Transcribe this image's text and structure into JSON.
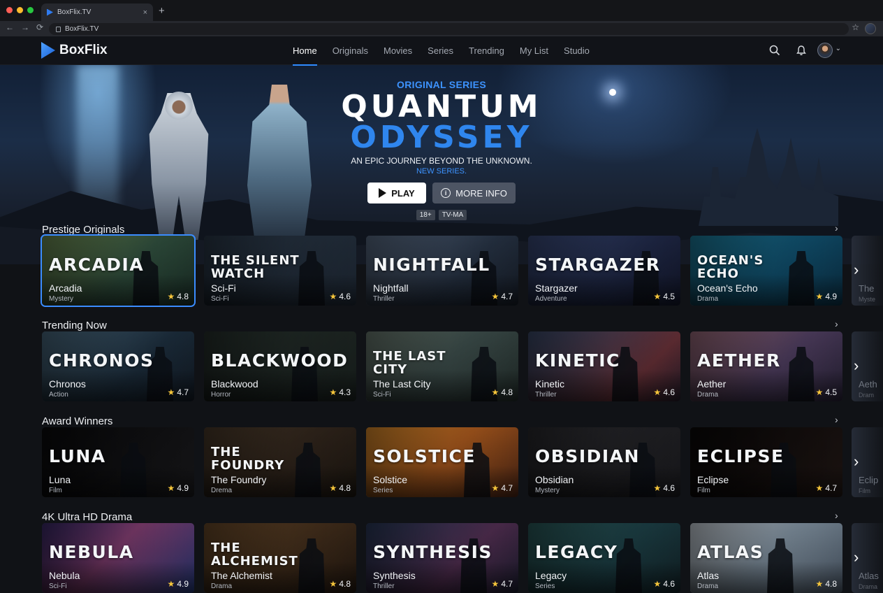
{
  "browser": {
    "tab_title": "BoxFlix.TV",
    "new_tab": "+",
    "close": "×",
    "url": "BoxFlix.TV",
    "back": "←",
    "forward": "→",
    "reload": "⟳",
    "bookmark": "☆"
  },
  "header": {
    "logo": "BoxFlix",
    "nav": [
      "Home",
      "Originals",
      "Movies",
      "Series",
      "Trending",
      "My List",
      "Studio"
    ],
    "active_nav": "Home",
    "caret": "⌄"
  },
  "hero": {
    "eyebrow": "ORIGINAL SERIES",
    "title_line1": "QUANTUM",
    "title_line2": "ODYSSEY",
    "tagline": "AN EPIC JOURNEY BEYOND THE UNKNOWN.",
    "tagline2": "NEW SERIES.",
    "play_label": "PLAY",
    "info_label": "MORE INFO",
    "info_glyph": "i",
    "badges": [
      "18+",
      "TV-MA"
    ]
  },
  "rows": [
    {
      "title": "Prestige Originals",
      "cards": [
        {
          "art": "ARCADIA",
          "name": "Arcadia",
          "genre": "Mystery",
          "rating": "4.8"
        },
        {
          "art": "THE SILENT WATCH",
          "name": "The Silent Watch",
          "display_name": "Sci-Fi",
          "genre": "Sci-Fi",
          "rating": "4.6"
        },
        {
          "art": "NIGHTFALL",
          "name": "Nightfall",
          "genre": "Thriller",
          "rating": "4.7"
        },
        {
          "art": "STARGAZER",
          "name": "Stargazer",
          "genre": "Adventure",
          "rating": "4.5"
        },
        {
          "art": "OCEAN'S ECHO",
          "name": "Ocean's Echo",
          "genre": "Drama",
          "rating": "4.9"
        }
      ],
      "peek": {
        "name": "The",
        "genre": "Myste"
      }
    },
    {
      "title": "Trending Now",
      "cards": [
        {
          "art": "CHRONOS",
          "name": "Chronos",
          "genre": "Action",
          "rating": "4.7"
        },
        {
          "art": "BLACKWOOD",
          "name": "Blackwood",
          "genre": "Horror",
          "rating": "4.3"
        },
        {
          "art": "THE LAST CITY",
          "name": "The Last City",
          "genre": "Sci-Fi",
          "rating": "4.8"
        },
        {
          "art": "KINETIC",
          "name": "Kinetic",
          "genre": "Thriller",
          "rating": "4.6"
        },
        {
          "art": "AETHER",
          "name": "Aether",
          "genre": "Drama",
          "rating": "4.5"
        }
      ],
      "peek": {
        "name": "Aeth",
        "genre": "Dram"
      }
    },
    {
      "title": "Award Winners",
      "cards": [
        {
          "art": "LUNA",
          "name": "Luna",
          "genre": "Film",
          "rating": "4.9"
        },
        {
          "art": "THE FOUNDRY",
          "name": "The Foundry",
          "genre": "Drema",
          "rating": "4.8"
        },
        {
          "art": "SOLSTICE",
          "name": "Solstice",
          "genre": "Series",
          "rating": "4.7"
        },
        {
          "art": "OBSIDIAN",
          "name": "Obsidian",
          "genre": "Mystery",
          "rating": "4.6"
        },
        {
          "art": "ECLIPSE",
          "name": "Eclipse",
          "genre": "Film",
          "rating": "4.7"
        }
      ],
      "peek": {
        "name": "Eclip",
        "genre": "Film"
      }
    },
    {
      "title": "4K Ultra HD Drama",
      "cards": [
        {
          "art": "NEBULA",
          "name": "Nebula",
          "genre": "Sci-Fi",
          "rating": "4.9"
        },
        {
          "art": "THE ALCHEMIST",
          "name": "The Alchemist",
          "genre": "Drama",
          "rating": "4.8"
        },
        {
          "art": "SYNTHESIS",
          "name": "Synthesis",
          "genre": "Thriller",
          "rating": "4.7"
        },
        {
          "art": "LEGACY",
          "name": "Legacy",
          "genre": "Series",
          "rating": "4.6"
        },
        {
          "art": "ATLAS",
          "name": "Atlas",
          "genre": "Drama",
          "rating": "4.8"
        }
      ],
      "peek": {
        "name": "Atlas",
        "genre": "Drama"
      }
    }
  ],
  "chevron": "›",
  "next_arrow": "›",
  "star_glyph": "★",
  "colors": {
    "accent": "#2f86ee",
    "rating_star": "#f5c53b",
    "selected_outline": "#3b8cff"
  },
  "icons": [
    "search-icon",
    "bell-icon",
    "avatar",
    "play-icon",
    "info-icon",
    "star-icon",
    "chevron-right-icon"
  ]
}
